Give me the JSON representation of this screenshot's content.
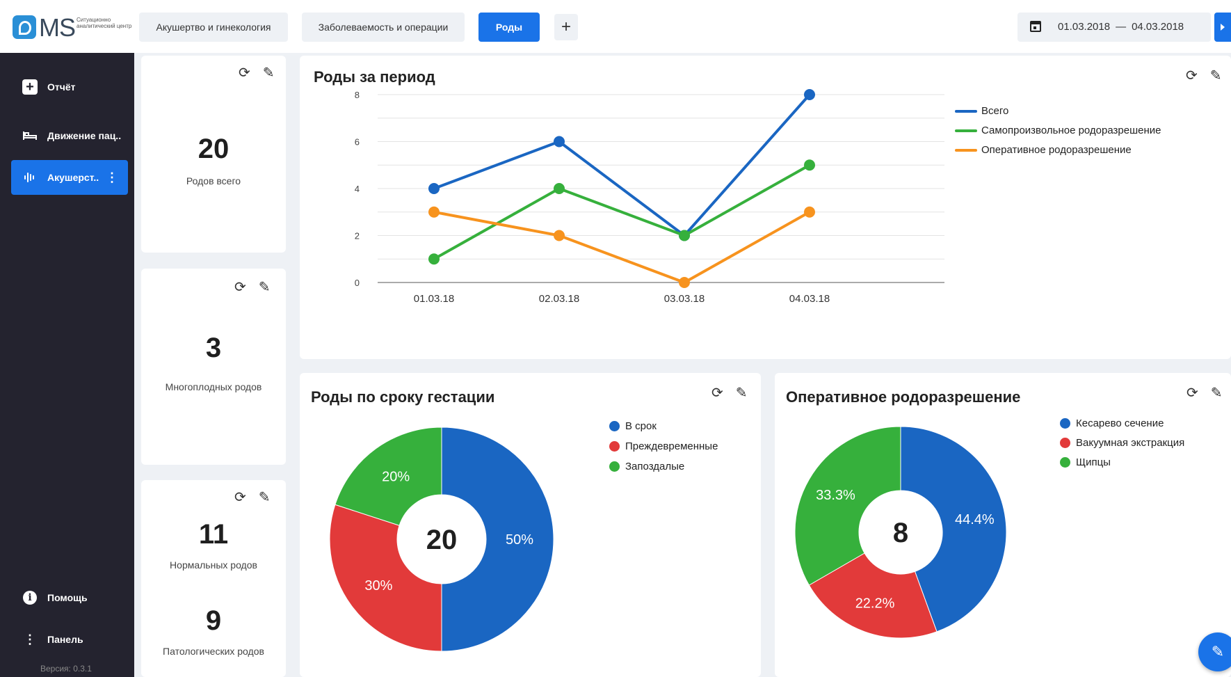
{
  "header": {
    "logo_text": "MS",
    "logo_subtitle": "Ситуационно аналитический центр",
    "tabs": [
      {
        "label": "Акушертво и гинекология",
        "active": false
      },
      {
        "label": "Заболеваемость и операции",
        "active": false
      },
      {
        "label": "Роды",
        "active": true
      }
    ],
    "add_tab_icon": "plus-icon",
    "add_tab_label": "+",
    "date_from": "01.03.2018",
    "date_sep": "—",
    "date_to": "04.03.2018"
  },
  "sidebar": {
    "items": [
      {
        "label": "Отчёт",
        "icon": "plus-square-icon"
      },
      {
        "label": "Движение пац..",
        "icon": "bed-icon"
      },
      {
        "label": "Акушерст..",
        "icon": "waveform-icon",
        "active": true
      }
    ],
    "footer": [
      {
        "label": "Помощь",
        "icon": "info-icon"
      },
      {
        "label": "Панель",
        "icon": "kebab-icon"
      }
    ],
    "version": "Версия: 0.3.1"
  },
  "kpis": [
    {
      "value": "20",
      "label": "Родов всего"
    },
    {
      "value": "3",
      "label": "Многоплодных родов"
    },
    {
      "value": "11",
      "label": "Нормальных родов"
    },
    {
      "value": "9",
      "label": "Патологических родов"
    }
  ],
  "chart_data": [
    {
      "type": "line",
      "title": "Роды за период",
      "categories": [
        "01.03.18",
        "02.03.18",
        "03.03.18",
        "04.03.18"
      ],
      "ylim": [
        0,
        8
      ],
      "yticks": [
        "0",
        "2",
        "4",
        "6",
        "8"
      ],
      "grid": true,
      "legend": "right",
      "series": [
        {
          "name": "Всего",
          "color": "#1a66c2",
          "values": [
            4,
            6,
            2,
            8
          ]
        },
        {
          "name": "Самопроизвольное родоразрешение",
          "color": "#36b03c",
          "values": [
            1,
            4,
            2,
            5
          ]
        },
        {
          "name": "Оперативное родоразрешение",
          "color": "#f7931e",
          "values": [
            3,
            2,
            0,
            3
          ]
        }
      ]
    },
    {
      "type": "pie",
      "title": "Роды по сроку гестации",
      "center_label": "20",
      "legend": "right",
      "slices": [
        {
          "label": "В срок",
          "value": 50,
          "text": "50%",
          "color": "#1a66c2"
        },
        {
          "label": "Преждевременные",
          "value": 30,
          "text": "30%",
          "color": "#e23a3a"
        },
        {
          "label": "Запоздалые",
          "value": 20,
          "text": "20%",
          "color": "#36b03c"
        }
      ]
    },
    {
      "type": "pie",
      "title": "Оперативное родоразрешение",
      "center_label": "8",
      "legend": "right",
      "slices": [
        {
          "label": "Кесарево сечение",
          "value": 44.4,
          "text": "44.4%",
          "color": "#1a66c2"
        },
        {
          "label": "Вакуумная экстракция",
          "value": 22.2,
          "text": "22.2%",
          "color": "#e23a3a"
        },
        {
          "label": "Щипцы",
          "value": 33.3,
          "text": "33.3%",
          "color": "#36b03c"
        }
      ]
    }
  ]
}
